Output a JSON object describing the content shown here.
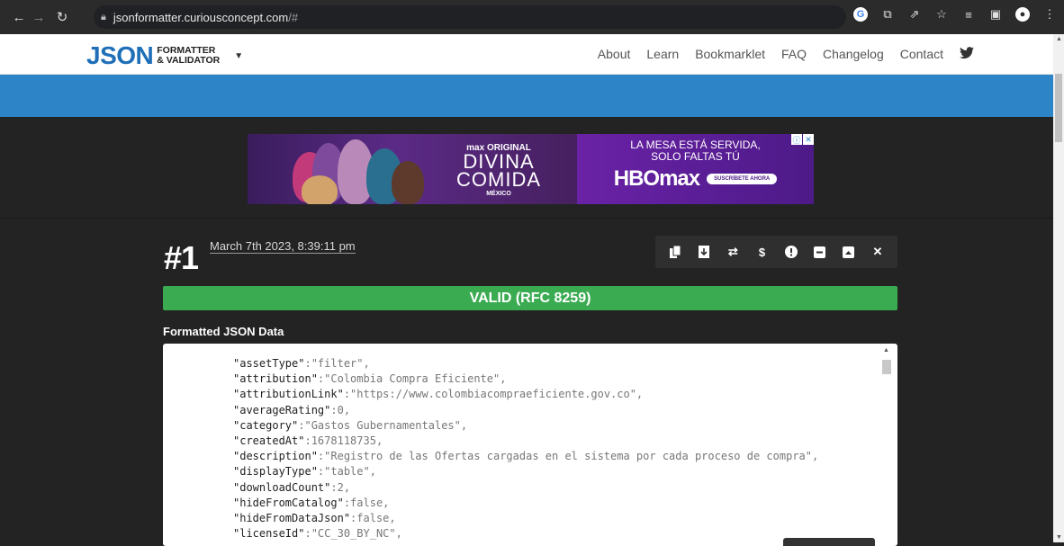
{
  "browser": {
    "url_host": "jsonformatter.curiousconcept.com",
    "url_rest": "/#"
  },
  "site": {
    "logo_main": "JSON",
    "logo_line1": "FORMATTER",
    "logo_line2": "& VALIDATOR",
    "nav": [
      "About",
      "Learn",
      "Bookmarklet",
      "FAQ",
      "Changelog",
      "Contact"
    ]
  },
  "ad": {
    "brand_tag": "max ORIGINAL",
    "show_line1": "DIVINA",
    "show_line2": "COMIDA",
    "country": "MÉXICO",
    "headline1": "LA MESA ESTÁ SERVIDA,",
    "headline2": "SOLO FALTAS TÚ",
    "hbo": "HBOmax",
    "cta": "SUSCRÍBETE AHORA"
  },
  "entry": {
    "number": "#1",
    "date": "March 7th 2023, 8:39:11 pm",
    "status": "VALID (RFC 8259)",
    "section_title": "Formatted JSON Data"
  },
  "json_lines": [
    {
      "key": "\"assetType\"",
      "val": ":\"filter\","
    },
    {
      "key": "\"attribution\"",
      "val": ":\"Colombia Compra Eficiente\","
    },
    {
      "key": "\"attributionLink\"",
      "val": ":\"https://www.colombiacompraeficiente.gov.co\","
    },
    {
      "key": "\"averageRating\"",
      "val": ":0,"
    },
    {
      "key": "\"category\"",
      "val": ":\"Gastos Gubernamentales\","
    },
    {
      "key": "\"createdAt\"",
      "val": ":1678118735,"
    },
    {
      "key": "\"description\"",
      "val": ":\"Registro de las Ofertas cargadas en el sistema por cada proceso de compra\","
    },
    {
      "key": "\"displayType\"",
      "val": ":\"table\","
    },
    {
      "key": "\"downloadCount\"",
      "val": ":2,"
    },
    {
      "key": "\"hideFromCatalog\"",
      "val": ":false,"
    },
    {
      "key": "\"hideFromDataJson\"",
      "val": ":false,"
    },
    {
      "key": "\"licenseId\"",
      "val": ":\"CC_30_BY_NC\","
    }
  ],
  "colors": {
    "valid_green": "#3bab52",
    "brand_blue": "#2d84c6",
    "page_bg": "#232323"
  }
}
